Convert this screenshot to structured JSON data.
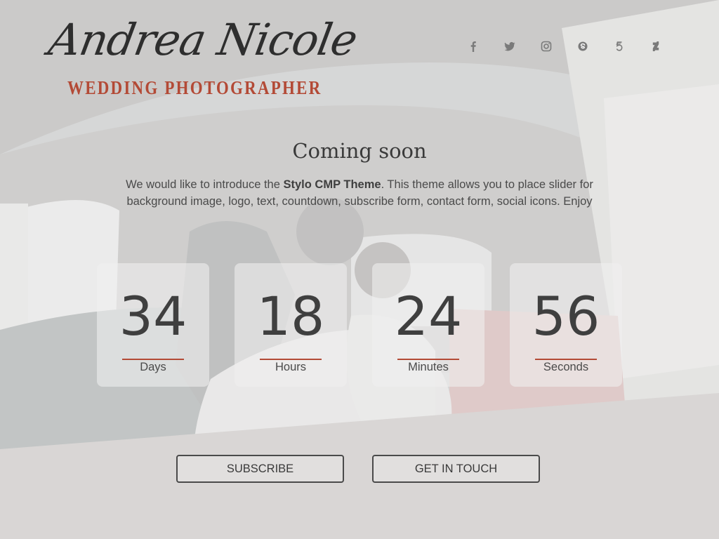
{
  "brand": {
    "name": "Andrea Nicole",
    "tagline": "WEDDING PHOTOGRAPHER",
    "script_color": "#2e2e2e",
    "accent_color": "#b34a36"
  },
  "social": {
    "links": [
      {
        "icon": "facebook-icon"
      },
      {
        "icon": "twitter-icon"
      },
      {
        "icon": "instagram-icon"
      },
      {
        "icon": "skype-icon"
      },
      {
        "icon": "500px-icon"
      },
      {
        "icon": "deviantart-icon"
      }
    ],
    "icon_color": "#7a7a7a"
  },
  "main": {
    "title": "Coming soon",
    "intro": {
      "before": "We would like to introduce the ",
      "bold": "Stylo CMP Theme",
      "after": ".  This theme allows you to place slider for background image, logo, text, countdown, subscribe form, contact form, social icons. Enjoy"
    }
  },
  "countdown": [
    {
      "value": "34",
      "unit": "Days"
    },
    {
      "value": "18",
      "unit": "Hours"
    },
    {
      "value": "24",
      "unit": "Minutes"
    },
    {
      "value": "56",
      "unit": "Seconds"
    }
  ],
  "buttons": {
    "subscribe": "SUBSCRIBE",
    "contact": "GET IN TOUCH"
  },
  "background": {
    "overlay_color": "#e8e8e8",
    "seat_color": "#b8514a"
  }
}
